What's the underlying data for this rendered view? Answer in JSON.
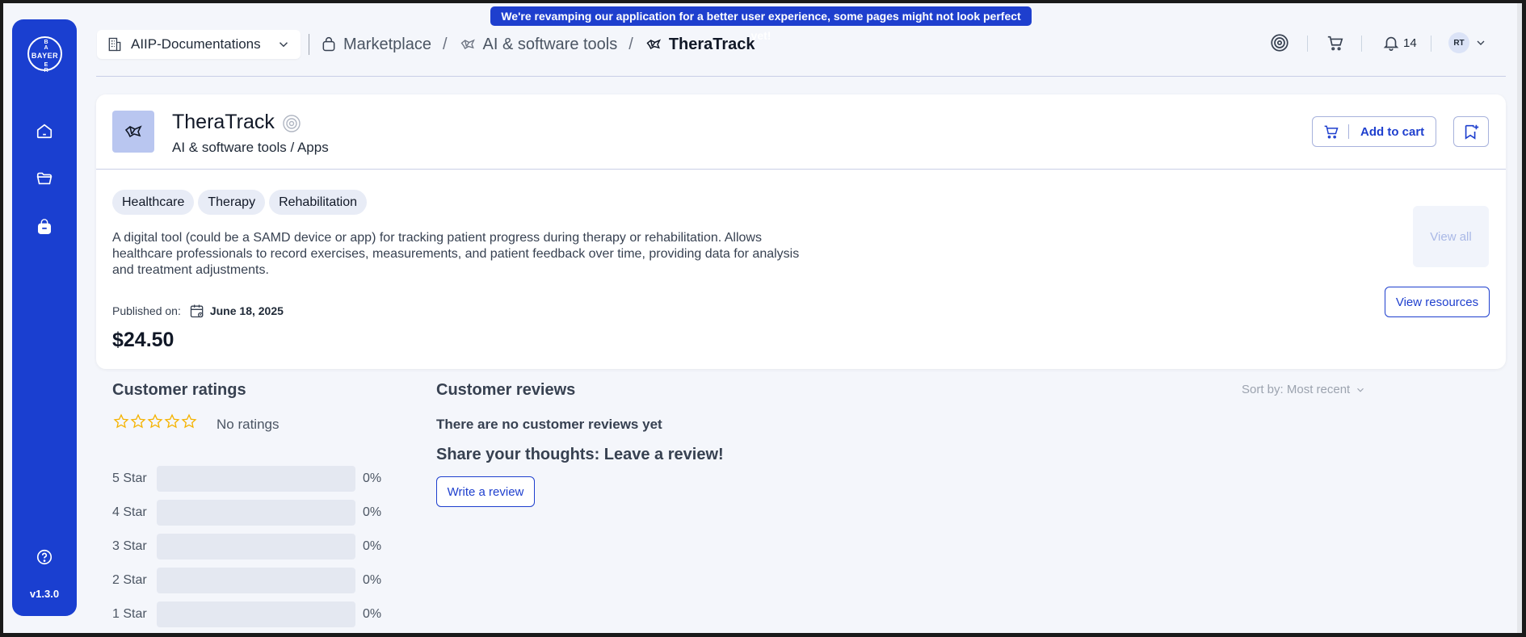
{
  "banner": {
    "text": "We're revamping our application for a better user experience, some pages might not look perfect yet!"
  },
  "sidebar": {
    "brand": "BAYER",
    "version": "v1.3.0",
    "items": [
      {
        "icon": "home-icon"
      },
      {
        "icon": "folder-icon"
      },
      {
        "icon": "bag-icon"
      }
    ],
    "help_icon": "help-icon"
  },
  "header": {
    "org_label": "AIIP-Documentations",
    "breadcrumbs": [
      "Marketplace",
      "AI & software tools",
      "TheraTrack"
    ],
    "notification_count": "14",
    "avatar_initials": "RT"
  },
  "product": {
    "title": "TheraTrack",
    "subtitle": "AI & software tools / Apps",
    "add_to_cart": "Add to cart",
    "tags": [
      "Healthcare",
      "Therapy",
      "Rehabilitation"
    ],
    "description": "A digital tool (could be a SAMD device or app) for tracking patient progress during therapy or rehabilitation. Allows healthcare professionals to record exercises, measurements, and patient feedback over time, providing data for analysis and treatment adjustments.",
    "view_all": "View all",
    "view_resources": "View resources",
    "published_label": "Published on:",
    "published_date": "June 18, 2025",
    "price": "$24.50"
  },
  "ratings": {
    "title": "Customer ratings",
    "summary": "No ratings",
    "stars_filled": 0,
    "rows": [
      {
        "label": "5 Star",
        "percent": "0%",
        "fraction": 0
      },
      {
        "label": "4 Star",
        "percent": "0%",
        "fraction": 0
      },
      {
        "label": "3 Star",
        "percent": "0%",
        "fraction": 0
      },
      {
        "label": "2 Star",
        "percent": "0%",
        "fraction": 0
      },
      {
        "label": "1 Star",
        "percent": "0%",
        "fraction": 0
      }
    ]
  },
  "reviews": {
    "title": "Customer reviews",
    "sort_label": "Sort by: Most recent",
    "empty_text": "There are no customer reviews yet",
    "share_text": "Share your thoughts: Leave a review!",
    "write_review": "Write a review"
  },
  "colors": {
    "primary": "#1e3fce",
    "star": "#f5b301"
  }
}
